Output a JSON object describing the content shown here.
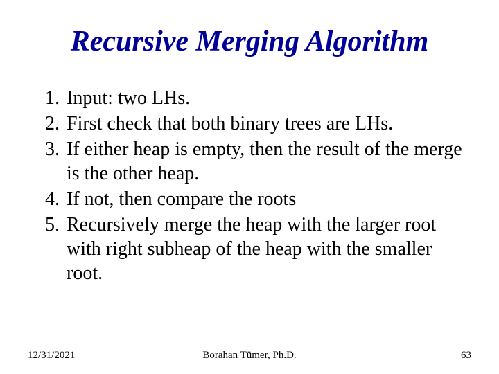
{
  "title": "Recursive Merging Algorithm",
  "items": [
    {
      "n": "1.",
      "t": "Input: two LHs."
    },
    {
      "n": "2.",
      "t": "First check that both binary trees are LHs."
    },
    {
      "n": "3.",
      "t": "If either heap is empty, then the result of the merge is the other heap."
    },
    {
      "n": "4.",
      "t": "If not, then compare the roots"
    },
    {
      "n": "5.",
      "t": "Recursively merge the heap with the larger root with right subheap of the heap with the smaller root."
    }
  ],
  "footer": {
    "date": "12/31/2021",
    "author": "Borahan Tümer, Ph.D.",
    "page": "63"
  }
}
